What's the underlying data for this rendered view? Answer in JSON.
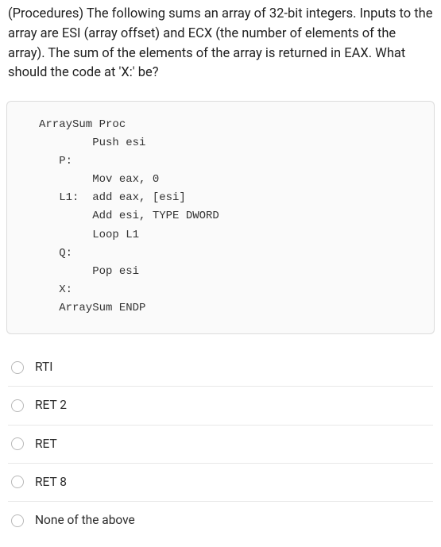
{
  "question": "(Procedures) The following sums an array of 32-bit integers. Inputs to the array are ESI (array offset) and ECX (the number of elements of the array).  The sum of the elements of the array is returned in EAX.     What should the code at 'X:' be?",
  "code": "ArraySum Proc\n        Push esi\n   P:\n        Mov eax, 0\n   L1:  add eax, [esi]\n        Add esi, TYPE DWORD\n        Loop L1\n   Q:\n        Pop esi\n   X:\n   ArraySum ENDP",
  "options": [
    {
      "label": "RTI"
    },
    {
      "label": "RET 2"
    },
    {
      "label": "RET"
    },
    {
      "label": "RET 8"
    },
    {
      "label": "None of the above"
    }
  ]
}
